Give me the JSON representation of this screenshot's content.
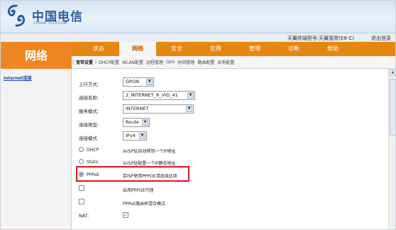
{
  "header": {
    "logo_text": "中国电信",
    "logo_sub": "CHINA TELECOM",
    "device_info": "天翼终端型号:天翼宽带(E8-C)",
    "logout": "退出登录"
  },
  "section_title": "网络",
  "main_tabs": [
    "状态",
    "网络",
    "安全",
    "应用",
    "管理",
    "诊断",
    "帮助"
  ],
  "active_main_tab": "网络",
  "sub_tabs": [
    "宽带设置",
    "DHCP配置",
    "WLAN配置",
    "远程管理",
    "QoS",
    "时间管理",
    "路由配置",
    "业务配置"
  ],
  "active_sub_tab": "宽带设置",
  "sidebar": {
    "link": "Internet连接"
  },
  "form": {
    "uplink": {
      "label": "上行方式:",
      "value": "GPON"
    },
    "conn_name": {
      "label": "连接名称:",
      "value": "2_INTERNET_R_VID_41"
    },
    "service_mode": {
      "label": "服务模式:",
      "value": "INTERNET"
    },
    "conn_type": {
      "label": "连接类型:",
      "value": "Route"
    },
    "conn_mode": {
      "label": "连接模式",
      "value": "IPv4"
    },
    "radios": [
      {
        "label": "DHCP",
        "desc": "从ISP处自动得到一个IP地址",
        "checked": false
      },
      {
        "label": "Static",
        "desc": "从ISP处配置一个IP静态地址",
        "checked": false
      },
      {
        "label": "PPPoE",
        "desc": "若ISP使用PPPOE请选择此项",
        "checked": true
      }
    ],
    "checkboxes": [
      {
        "desc": "启用PPPOE代理",
        "checked": false
      },
      {
        "desc": "PPPoE路由桥混合模式",
        "checked": false
      }
    ],
    "nat": {
      "label": "NAT:",
      "checked": true
    }
  },
  "colors": {
    "accent_orange": "#e7860f",
    "highlight_red": "#e0121a",
    "link_blue": "#1a45a8"
  }
}
